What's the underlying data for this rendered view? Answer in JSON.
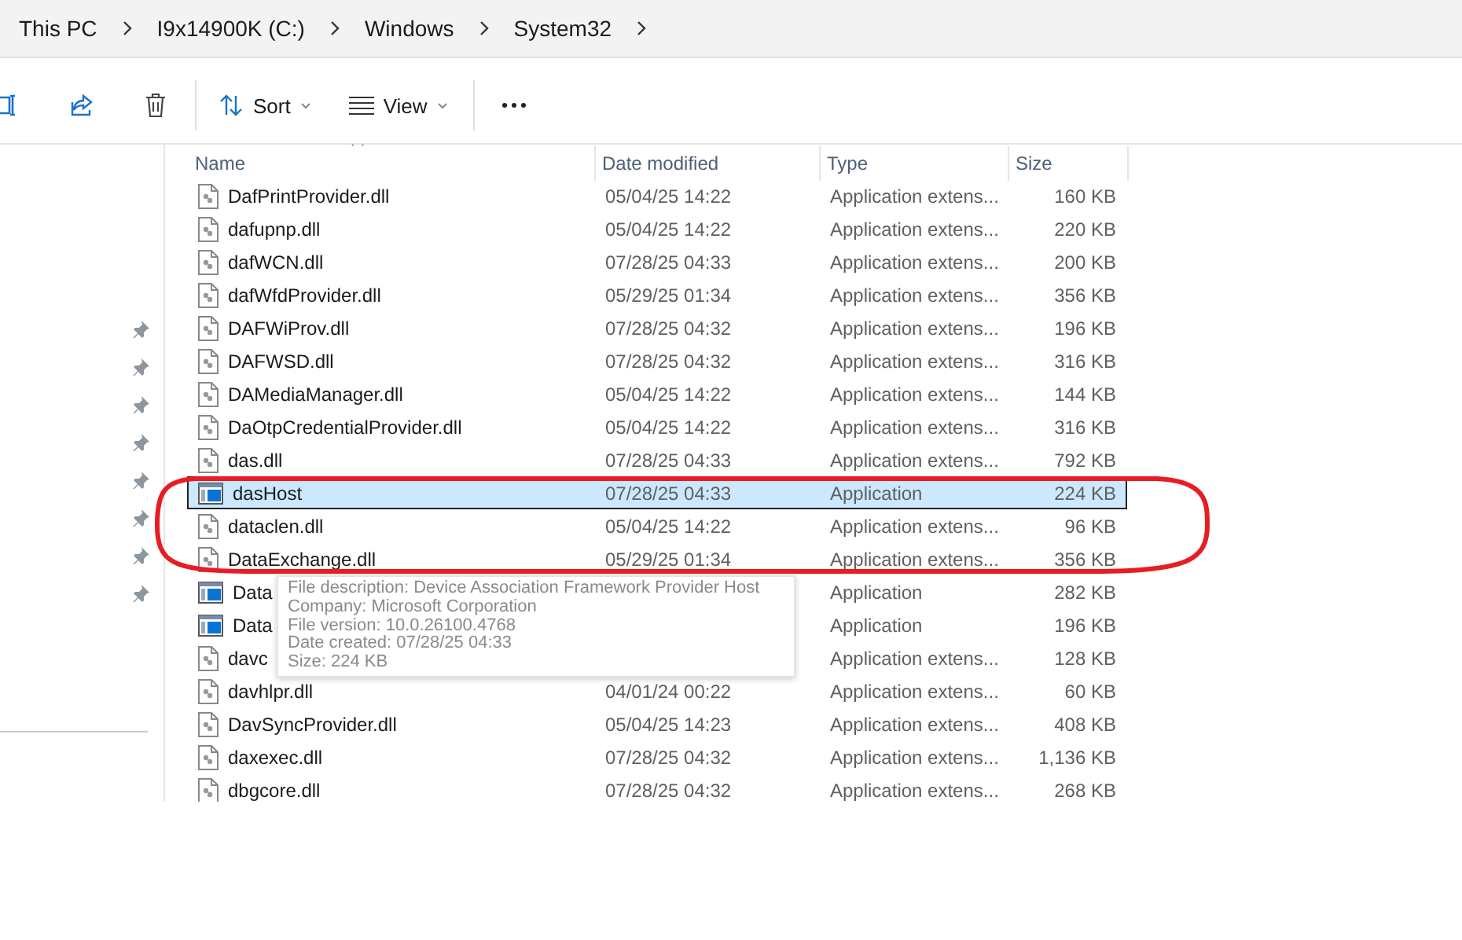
{
  "breadcrumb": [
    {
      "label": "This PC"
    },
    {
      "label": "I9x14900K (C:)"
    },
    {
      "label": "Windows"
    },
    {
      "label": "System32"
    }
  ],
  "toolbar": {
    "sort": "Sort",
    "view": "View"
  },
  "table": {
    "columns": [
      "Name",
      "Date modified",
      "Type",
      "Size"
    ],
    "rows": [
      {
        "kind": "dll",
        "name": "DafPrintProvider.dll",
        "date": "05/04/25 14:22",
        "type": "Application extens...",
        "size": "160 KB",
        "selected": false
      },
      {
        "kind": "dll",
        "name": "dafupnp.dll",
        "date": "05/04/25 14:22",
        "type": "Application extens...",
        "size": "220 KB",
        "selected": false
      },
      {
        "kind": "dll",
        "name": "dafWCN.dll",
        "date": "07/28/25 04:33",
        "type": "Application extens...",
        "size": "200 KB",
        "selected": false
      },
      {
        "kind": "dll",
        "name": "dafWfdProvider.dll",
        "date": "05/29/25 01:34",
        "type": "Application extens...",
        "size": "356 KB",
        "selected": false
      },
      {
        "kind": "dll",
        "name": "DAFWiProv.dll",
        "date": "07/28/25 04:32",
        "type": "Application extens...",
        "size": "196 KB",
        "selected": false
      },
      {
        "kind": "dll",
        "name": "DAFWSD.dll",
        "date": "07/28/25 04:32",
        "type": "Application extens...",
        "size": "316 KB",
        "selected": false
      },
      {
        "kind": "dll",
        "name": "DAMediaManager.dll",
        "date": "05/04/25 14:22",
        "type": "Application extens...",
        "size": "144 KB",
        "selected": false
      },
      {
        "kind": "dll",
        "name": "DaOtpCredentialProvider.dll",
        "date": "05/04/25 14:22",
        "type": "Application extens...",
        "size": "316 KB",
        "selected": false
      },
      {
        "kind": "dll",
        "name": "das.dll",
        "date": "07/28/25 04:33",
        "type": "Application extens...",
        "size": "792 KB",
        "selected": false
      },
      {
        "kind": "app",
        "name": "dasHost",
        "date": "07/28/25 04:33",
        "type": "Application",
        "size": "224 KB",
        "selected": true
      },
      {
        "kind": "dll",
        "name": "dataclen.dll",
        "date": "05/04/25 14:22",
        "type": "Application extens...",
        "size": "96 KB",
        "selected": false
      },
      {
        "kind": "dll",
        "name": "DataExchange.dll",
        "date": "05/29/25 01:34",
        "type": "Application extens...",
        "size": "356 KB",
        "selected": false
      },
      {
        "kind": "app",
        "name": "Data",
        "type": "Application",
        "size": "282 KB",
        "selected": false
      },
      {
        "kind": "app",
        "name": "Data",
        "type": "Application",
        "size": "196 KB",
        "selected": false
      },
      {
        "kind": "dll",
        "name": "davc",
        "type": "Application extens...",
        "size": "128 KB",
        "selected": false
      },
      {
        "kind": "dll",
        "name": "davhlpr.dll",
        "date": "04/01/24 00:22",
        "type": "Application extens...",
        "size": "60 KB",
        "selected": false
      },
      {
        "kind": "dll",
        "name": "DavSyncProvider.dll",
        "date": "05/04/25 14:23",
        "type": "Application extens...",
        "size": "408 KB",
        "selected": false
      },
      {
        "kind": "dll",
        "name": "daxexec.dll",
        "date": "07/28/25 04:32",
        "type": "Application extens...",
        "size": "1,136 KB",
        "selected": false
      },
      {
        "kind": "dll",
        "name": "dbgcore.dll",
        "date": "07/28/25 04:32",
        "type": "Application extens...",
        "size": "268 KB",
        "selected": false
      }
    ]
  },
  "tooltip": [
    "File description: Device Association Framework Provider Host",
    "Company: Microsoft Corporation",
    "File version: 10.0.26100.4768",
    "Date created: 07/28/25 04:33",
    "Size: 224 KB"
  ]
}
